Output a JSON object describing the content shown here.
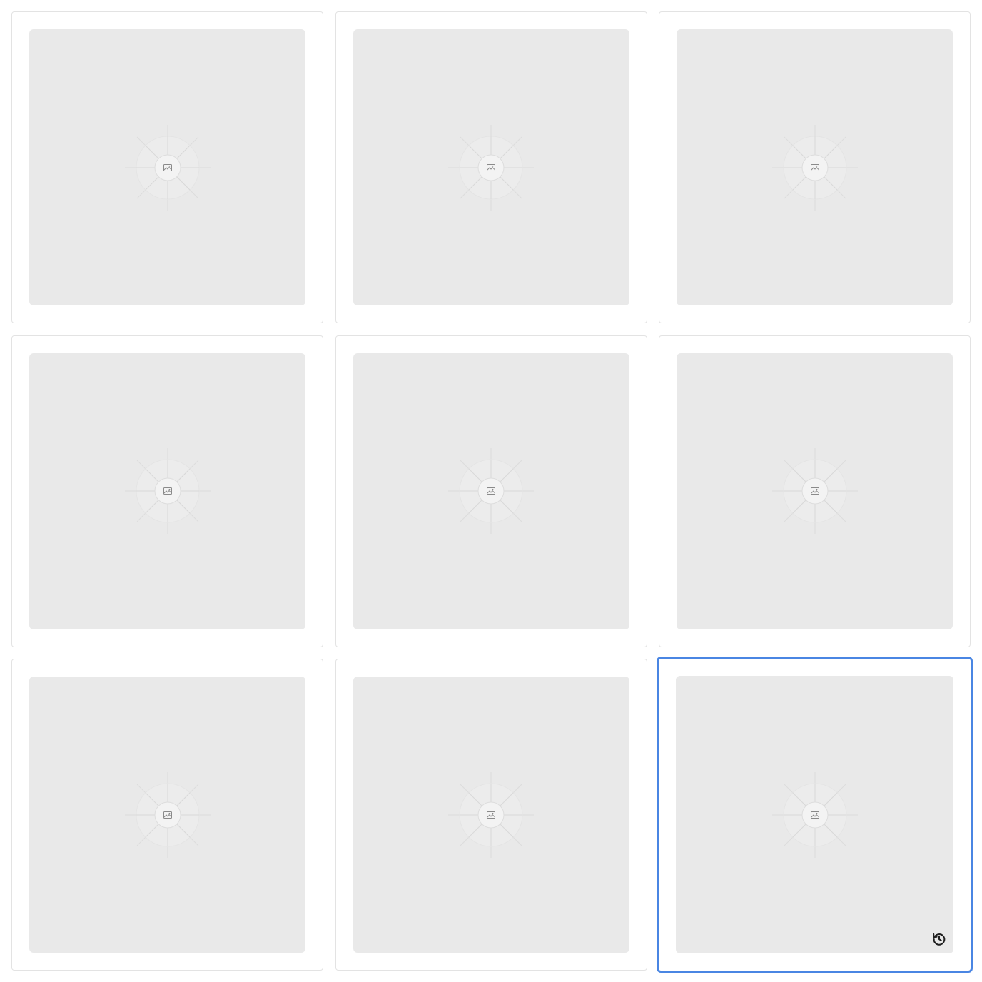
{
  "gallery": {
    "tiles": [
      {
        "icon": "image-placeholder-icon",
        "selected": false
      },
      {
        "icon": "image-placeholder-icon",
        "selected": false
      },
      {
        "icon": "image-placeholder-icon",
        "selected": false
      },
      {
        "icon": "image-placeholder-icon",
        "selected": false
      },
      {
        "icon": "image-placeholder-icon",
        "selected": false
      },
      {
        "icon": "image-placeholder-icon",
        "selected": false
      },
      {
        "icon": "image-placeholder-icon",
        "selected": false
      },
      {
        "icon": "image-placeholder-icon",
        "selected": false
      },
      {
        "icon": "image-placeholder-icon",
        "selected": true,
        "action_icon": "history-icon"
      }
    ],
    "colors": {
      "selected_border": "#4a86e3",
      "tile_border": "#e3e3e3",
      "thumb_background": "#e9e9e9"
    }
  }
}
